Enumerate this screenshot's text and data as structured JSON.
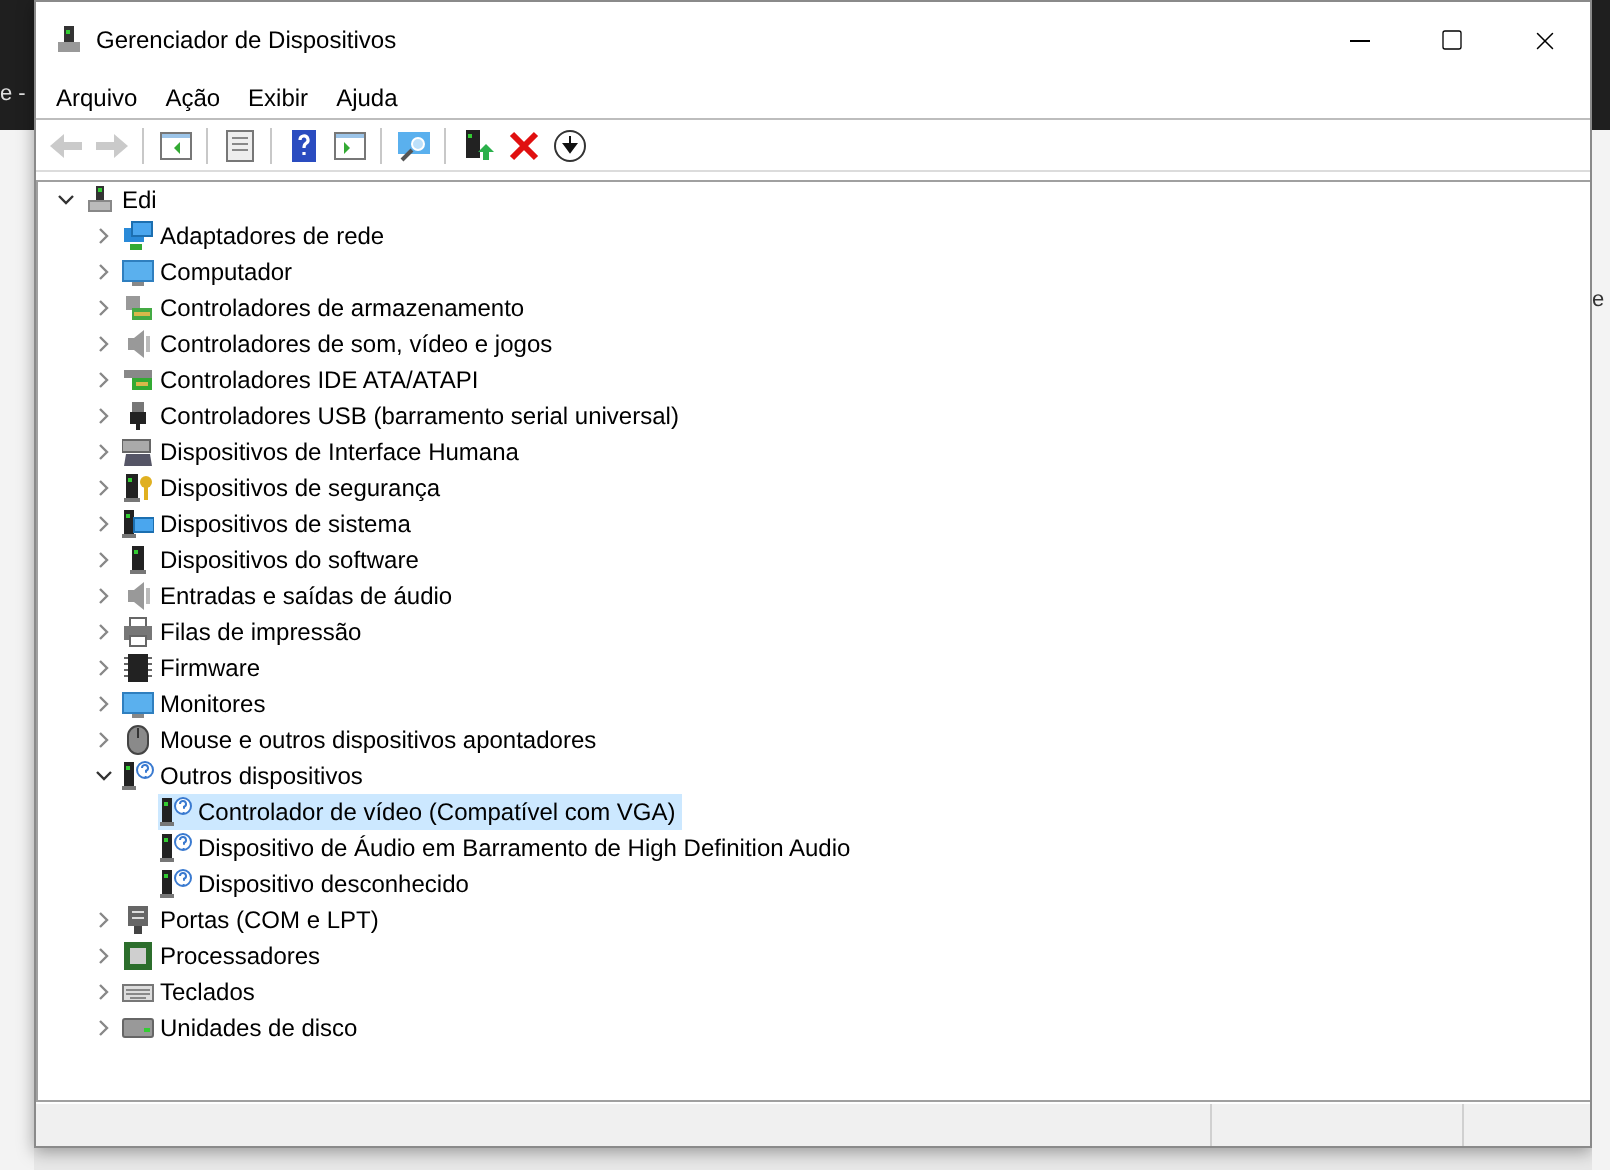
{
  "background": {
    "fragment_left": "e -",
    "fragment_right": "e"
  },
  "window": {
    "title": "Gerenciador de Dispositivos"
  },
  "menu": [
    "Arquivo",
    "Ação",
    "Exibir",
    "Ajuda"
  ],
  "toolbar": [
    {
      "kind": "back",
      "disabled": true
    },
    {
      "kind": "forward",
      "disabled": true
    },
    {
      "kind": "separator"
    },
    {
      "kind": "tree-pane",
      "disabled": false
    },
    {
      "kind": "separator"
    },
    {
      "kind": "properties",
      "disabled": false
    },
    {
      "kind": "separator"
    },
    {
      "kind": "help",
      "disabled": false
    },
    {
      "kind": "action-pane",
      "disabled": false
    },
    {
      "kind": "separator"
    },
    {
      "kind": "scan",
      "disabled": false
    },
    {
      "kind": "separator"
    },
    {
      "kind": "update",
      "disabled": false
    },
    {
      "kind": "uninstall",
      "disabled": false
    },
    {
      "kind": "download",
      "disabled": false
    }
  ],
  "tree": {
    "label": "Edi",
    "kind": "root",
    "expanded": true,
    "selected": false,
    "children": [
      {
        "label": "Adaptadores de rede",
        "kind": "network",
        "expanded": false,
        "selected": false
      },
      {
        "label": "Computador",
        "kind": "computer",
        "expanded": false,
        "selected": false
      },
      {
        "label": "Controladores de armazenamento",
        "kind": "storage",
        "expanded": false,
        "selected": false
      },
      {
        "label": "Controladores de som, vídeo e jogos",
        "kind": "speaker",
        "expanded": false,
        "selected": false
      },
      {
        "label": "Controladores IDE ATA/ATAPI",
        "kind": "ide",
        "expanded": false,
        "selected": false
      },
      {
        "label": "Controladores USB (barramento serial universal)",
        "kind": "usb",
        "expanded": false,
        "selected": false
      },
      {
        "label": "Dispositivos de Interface Humana",
        "kind": "hid",
        "expanded": false,
        "selected": false
      },
      {
        "label": "Dispositivos de segurança",
        "kind": "security",
        "expanded": false,
        "selected": false
      },
      {
        "label": "Dispositivos de sistema",
        "kind": "system",
        "expanded": false,
        "selected": false
      },
      {
        "label": "Dispositivos do software",
        "kind": "software",
        "expanded": false,
        "selected": false
      },
      {
        "label": "Entradas e saídas de áudio",
        "kind": "speaker",
        "expanded": false,
        "selected": false
      },
      {
        "label": "Filas de impressão",
        "kind": "printer",
        "expanded": false,
        "selected": false
      },
      {
        "label": "Firmware",
        "kind": "chip",
        "expanded": false,
        "selected": false
      },
      {
        "label": "Monitores",
        "kind": "monitor",
        "expanded": false,
        "selected": false
      },
      {
        "label": "Mouse e outros dispositivos apontadores",
        "kind": "mouse",
        "expanded": false,
        "selected": false
      },
      {
        "label": "Outros dispositivos",
        "kind": "unknown",
        "expanded": true,
        "selected": false,
        "children": [
          {
            "label": "Controlador de vídeo (Compatível com VGA)",
            "kind": "unknown",
            "selected": true
          },
          {
            "label": "Dispositivo de Áudio em Barramento de High Definition Audio",
            "kind": "unknown",
            "selected": false
          },
          {
            "label": "Dispositivo desconhecido",
            "kind": "unknown",
            "selected": false
          }
        ]
      },
      {
        "label": "Portas (COM e LPT)",
        "kind": "port",
        "expanded": false,
        "selected": false
      },
      {
        "label": "Processadores",
        "kind": "cpu",
        "expanded": false,
        "selected": false
      },
      {
        "label": "Teclados",
        "kind": "keyboard",
        "expanded": false,
        "selected": false
      },
      {
        "label": "Unidades de disco",
        "kind": "disk",
        "expanded": false,
        "selected": false
      }
    ]
  }
}
